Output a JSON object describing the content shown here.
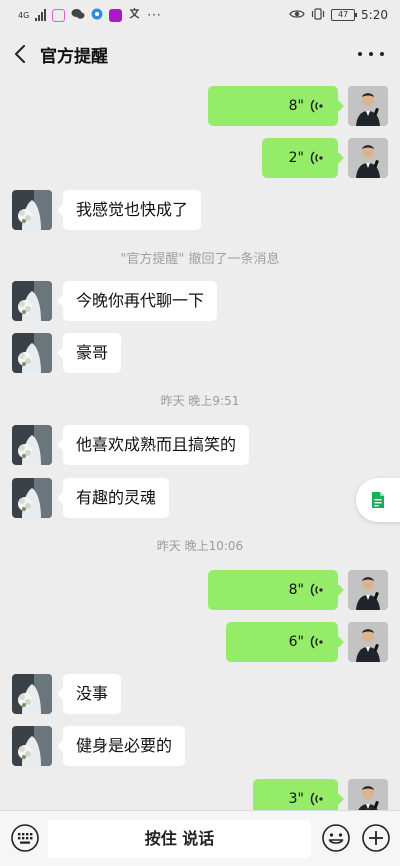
{
  "status_bar": {
    "network": "4G",
    "time": "5:20",
    "battery": "47"
  },
  "header": {
    "title": "官方提醒"
  },
  "messages": [
    {
      "dir": "out",
      "kind": "voice",
      "duration": "8\""
    },
    {
      "dir": "out",
      "kind": "voice",
      "duration": "2\""
    },
    {
      "dir": "in",
      "kind": "text",
      "text": "我感觉也快成了"
    },
    {
      "kind": "recall",
      "text": "\"官方提醒\" 撤回了一条消息"
    },
    {
      "dir": "in",
      "kind": "text",
      "text": "今晚你再代聊一下"
    },
    {
      "dir": "in",
      "kind": "text",
      "text": "豪哥"
    },
    {
      "kind": "time",
      "text": "昨天 晚上9:51"
    },
    {
      "dir": "in",
      "kind": "text",
      "text": "他喜欢成熟而且搞笑的"
    },
    {
      "dir": "in",
      "kind": "text",
      "text": "有趣的灵魂"
    },
    {
      "kind": "time",
      "text": "昨天 晚上10:06"
    },
    {
      "dir": "out",
      "kind": "voice",
      "duration": "8\""
    },
    {
      "dir": "out",
      "kind": "voice",
      "duration": "6\""
    },
    {
      "dir": "in",
      "kind": "text",
      "text": "没事"
    },
    {
      "dir": "in",
      "kind": "text",
      "text": "健身是必要的"
    },
    {
      "dir": "out",
      "kind": "voice",
      "duration": "3\""
    }
  ],
  "input_bar": {
    "hold_to_talk_label": "按住 说话"
  },
  "colors": {
    "background": "#ededed",
    "outgoing_bubble": "#95ec69",
    "incoming_bubble": "#ffffff",
    "side_doc_icon": "#1aad5a"
  },
  "icons": {
    "back": "chevron-left-icon",
    "more": "more-dots-icon",
    "voice": "voice-wave-icon",
    "keyboard": "keyboard-icon",
    "emoji": "emoji-icon",
    "add": "plus-circle-icon",
    "side_doc": "document-icon"
  }
}
